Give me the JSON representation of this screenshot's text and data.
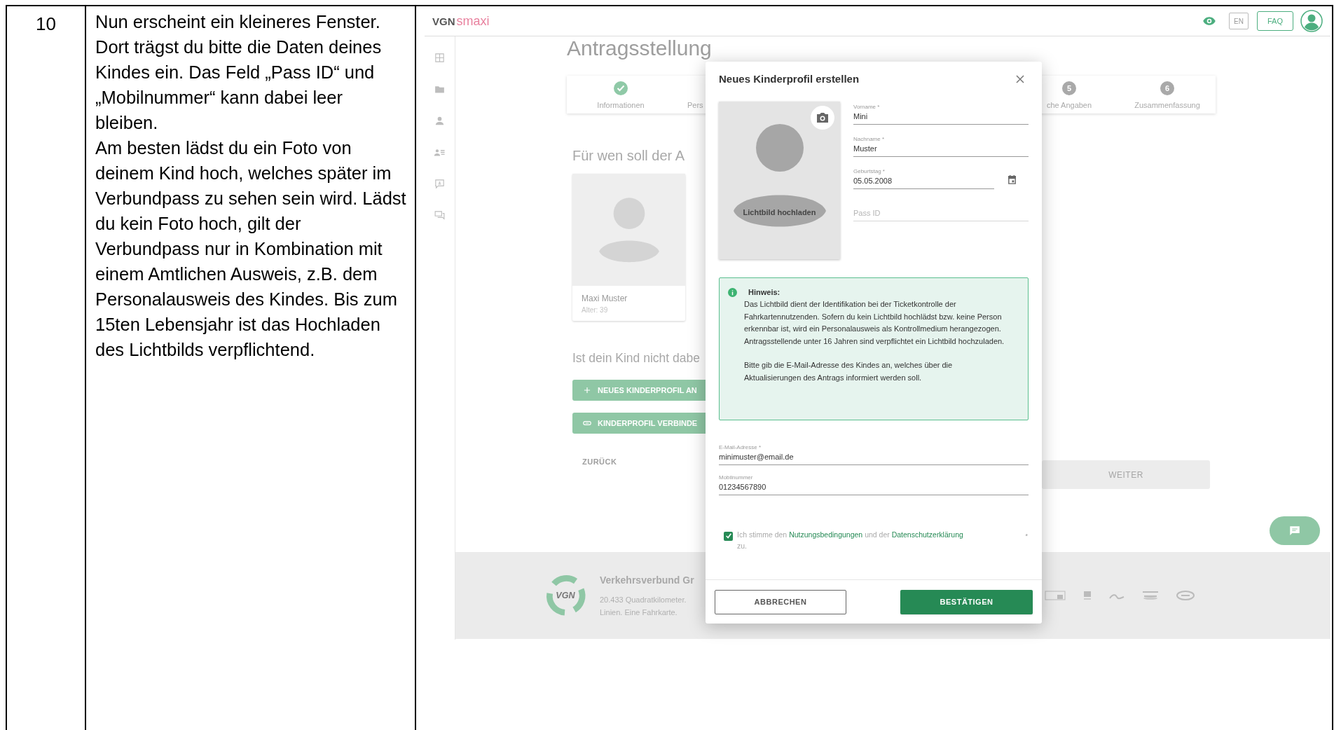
{
  "document_row": {
    "number": "10",
    "paragraphs": [
      "Nun erscheint ein kleineres Fenster. Dort trägst du bitte die Daten deines Kindes ein. Das Feld „Pass ID“ und „Mobilnummer“ kann dabei leer bleiben.",
      "Am besten lädst du ein Foto von deinem Kind hoch, welches später im Verbundpass zu sehen sein wird. Lädst du kein Foto hoch, gilt der Verbundpass nur in Kombination mit einem Amtlichen Ausweis, z.B. dem Personalausweis des Kindes. Bis zum 15ten Lebensjahr ist das Hochladen des Lichtbilds verpflichtend."
    ]
  },
  "app": {
    "header": {
      "logo_brand": "VGN",
      "logo_product": "smaxi",
      "language": "EN",
      "faq": "FAQ"
    },
    "page_title": "Antragsstellung",
    "stepper": [
      {
        "label": "Informationen",
        "completed": true
      },
      {
        "label": "Pers",
        "completed": false
      },
      {
        "number": "5",
        "label": "che Angaben",
        "completed": false
      },
      {
        "number": "6",
        "label": "Zusammenfassung",
        "completed": false
      }
    ],
    "section_heading": "Für wen soll der A",
    "profiles": [
      {
        "name": "Maxi Muster",
        "age": "Alter: 39"
      }
    ],
    "missing_heading": "Ist dein Kind nicht dabe",
    "actions": [
      {
        "kind": "add",
        "label": "NEUES KINDERPROFIL AN"
      },
      {
        "kind": "link",
        "label": "KINDERPROFIL VERBINDE"
      }
    ],
    "back": "ZURÜCK",
    "next": {
      "label": "WEITER",
      "disabled": true
    },
    "footer": {
      "logo_text": "VGN",
      "title": "Verkehrsverbund Gr",
      "lines": [
        "20.433 Quadratkilometer.",
        "Linien. Eine Fahrkarte."
      ]
    },
    "dialog": {
      "title": "Neues Kinderprofil erstellen",
      "photo_label": "Lichtbild hochladen",
      "fields": [
        {
          "kind": "text",
          "label": "Vorname *",
          "value": "Mini"
        },
        {
          "kind": "text",
          "label": "Nachname *",
          "value": "Muster"
        },
        {
          "kind": "date",
          "label": "Geburtstag *",
          "value": "05.05.2008"
        },
        {
          "kind": "text",
          "placeholder": "Pass ID"
        }
      ],
      "notice": {
        "title": "Hinweis:",
        "groups": [
          [
            "Das Lichtbild dient der Identifikation bei der Ticketkontrolle der Fahrkartennutzenden. Sofern du kein Lichtbild hochlädst bzw. keine Person erkennbar ist, wird ein Personalausweis als Kontrollmedium herangezogen.",
            "Antragsstellende unter 16 Jahren sind verpflichtet ein Lichtbild hochzuladen."
          ],
          [
            "Bitte gib die E-Mail-Adresse des Kindes an, welches über die Aktualisierungen des Antrags informiert werden soll."
          ]
        ]
      },
      "contact_fields": [
        {
          "label": "E-Mail-Adresse *",
          "value": "minimuster@email.de"
        },
        {
          "label": "Mobilnummer",
          "value": "01234567890"
        }
      ],
      "consent": {
        "checked": true,
        "parts": [
          {
            "kind": "text",
            "text": "Ich stimme den "
          },
          {
            "kind": "link",
            "text": "Nutzungsbedingungen"
          },
          {
            "kind": "text",
            "text": " und der "
          },
          {
            "kind": "link",
            "text": "Datenschutzerklärung"
          },
          {
            "kind": "text",
            "text": " zu."
          }
        ],
        "required_mark": "*"
      },
      "cancel": "ABBRECHEN",
      "confirm": "BESTÄTIGEN"
    }
  }
}
